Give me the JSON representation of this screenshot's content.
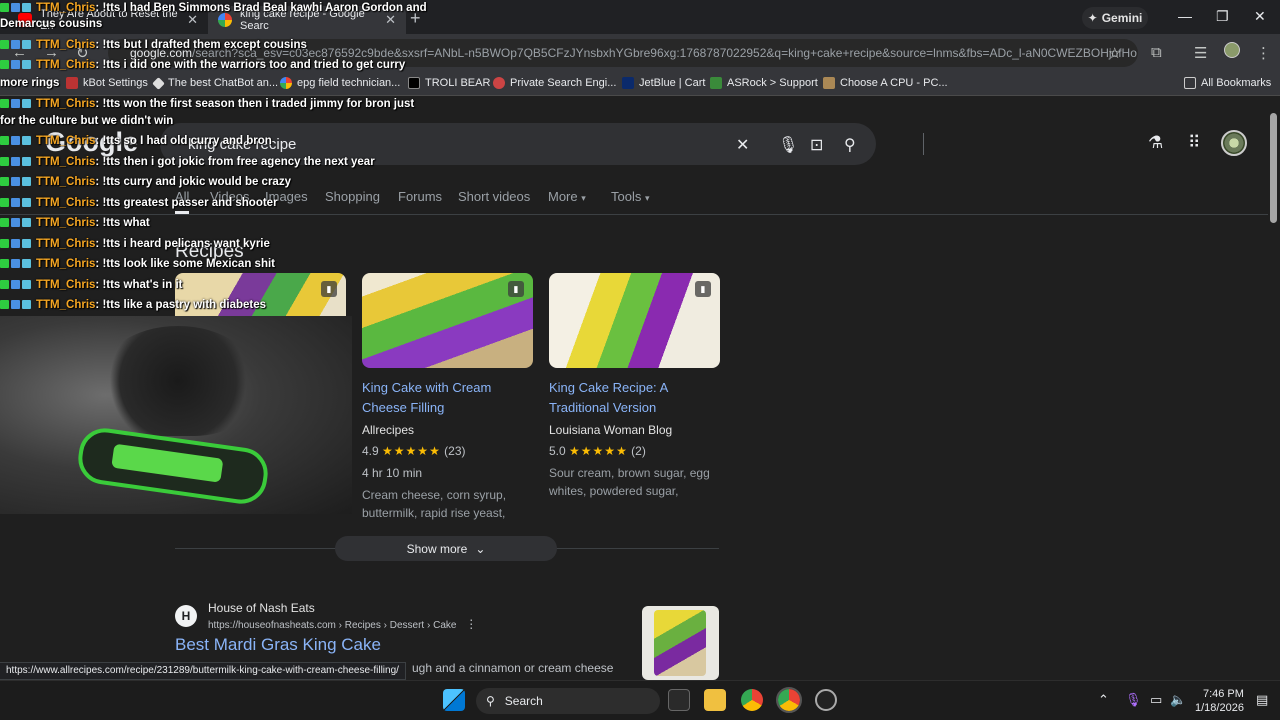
{
  "browser": {
    "tabs": [
      {
        "label": "They Are About to Reset the En",
        "active": false
      },
      {
        "label": "king cake recipe - Google Searc",
        "active": true
      }
    ],
    "gemini_label": "Gemini",
    "address": {
      "host": "google.com",
      "path": "/search?sca_esv=c03ec876592c9bde&sxsrf=ANbL-n5BWOp7QB5CFzJYnsbxhYGbre96xg:1768787022952&q=king+cake+recipe&source=lnms&fbs=ADc_l-aN0CWEZBOHjofHo..."
    },
    "bookmarks": [
      {
        "label": "kBot Settings",
        "icon": "bot-icon"
      },
      {
        "label": "The best ChatBot an...",
        "icon": "chatbot-icon"
      },
      {
        "label": "epg field technician...",
        "icon": "google-icon"
      },
      {
        "label": "TROLI BEAR",
        "icon": "t-icon"
      },
      {
        "label": "Private Search Engi...",
        "icon": "private-search-icon"
      },
      {
        "label": "JetBlue | Cart",
        "icon": "jetblue-icon"
      },
      {
        "label": "ASRock > Support",
        "icon": "asrock-icon"
      },
      {
        "label": "Choose A CPU - PC...",
        "icon": "cpu-icon"
      }
    ],
    "all_bookmarks": "All Bookmarks",
    "status_url": "https://www.allrecipes.com/recipe/231289/buttermilk-king-cake-with-cream-cheese-filling/"
  },
  "search": {
    "logo": "Google",
    "query": "king cake recipe",
    "nav_tabs": [
      "All",
      "Videos",
      "Images",
      "Shopping",
      "Forums",
      "Short videos",
      "More",
      "Tools"
    ]
  },
  "recipes": {
    "heading": "Recipes",
    "cards": [
      {
        "title": "King Cake with Cream Cheese Filling",
        "source": "Allrecipes",
        "rating": "4.9",
        "stars": "★★★★★",
        "count": "(23)",
        "time": "4 hr 10 min",
        "ingredients": "Cream cheese, corn syrup, buttermilk, rapid rise yeast,"
      },
      {
        "title": "King Cake Recipe: A Traditional Version",
        "source": "Louisiana Woman Blog",
        "rating": "5.0",
        "stars": "★★★★★",
        "count": "(2)",
        "ingredients": "Sour cream, brown sugar, egg whites, powdered sugar,"
      }
    ],
    "show_more": "Show more"
  },
  "result": {
    "favicon_letter": "H",
    "site": "House of Nash Eats",
    "url": "https://houseofnasheats.com › Recipes › Dessert › Cake",
    "title": "Best Mardi Gras King Cake",
    "snippet": "ugh and a cinnamon or cream cheese"
  },
  "chat": [
    {
      "user": "TTM_Chris",
      "text": ": !tts I had Ben Simmons Brad Beal kawhi Aaron Gordon and"
    },
    {
      "user": "",
      "text": "Demarcus cousins"
    },
    {
      "user": "TTM_Chris",
      "text": ": !tts but I drafted them except cousins"
    },
    {
      "user": "TTM_Chris",
      "text": ": !tts i did one with the warriors too and tried to get curry"
    },
    {
      "user": "",
      "text": "more rings"
    },
    {
      "user": "TTM_Chris",
      "text": ": !tts won the first season then i traded jimmy for bron just"
    },
    {
      "user": "",
      "text": "for the culture but we didn't win"
    },
    {
      "user": "TTM_Chris",
      "text": ": !tts so I had old curry and bron"
    },
    {
      "user": "TTM_Chris",
      "text": ": !tts then i got jokic from free agency the next year"
    },
    {
      "user": "TTM_Chris",
      "text": ": !tts curry and jokic would be crazy"
    },
    {
      "user": "TTM_Chris",
      "text": ": !tts greatest passer and shooter"
    },
    {
      "user": "TTM_Chris",
      "text": ": !tts what"
    },
    {
      "user": "TTM_Chris",
      "text": ": !tts i heard pelicans want kyrie"
    },
    {
      "user": "TTM_Chris",
      "text": ": !tts look like some Mexican shit"
    },
    {
      "user": "TTM_Chris",
      "text": ": !tts what's in it"
    },
    {
      "user": "TTM_Chris",
      "text": ": !tts like a pastry with diabetes"
    }
  ],
  "taskbar": {
    "search_label": "Search",
    "time": "7:46 PM",
    "date": "1/18/2026"
  },
  "colors": {
    "link": "#8ab4f8",
    "star": "#fbbc04",
    "chat_user": "#f5a623",
    "page_bg": "#1f1f1f"
  }
}
